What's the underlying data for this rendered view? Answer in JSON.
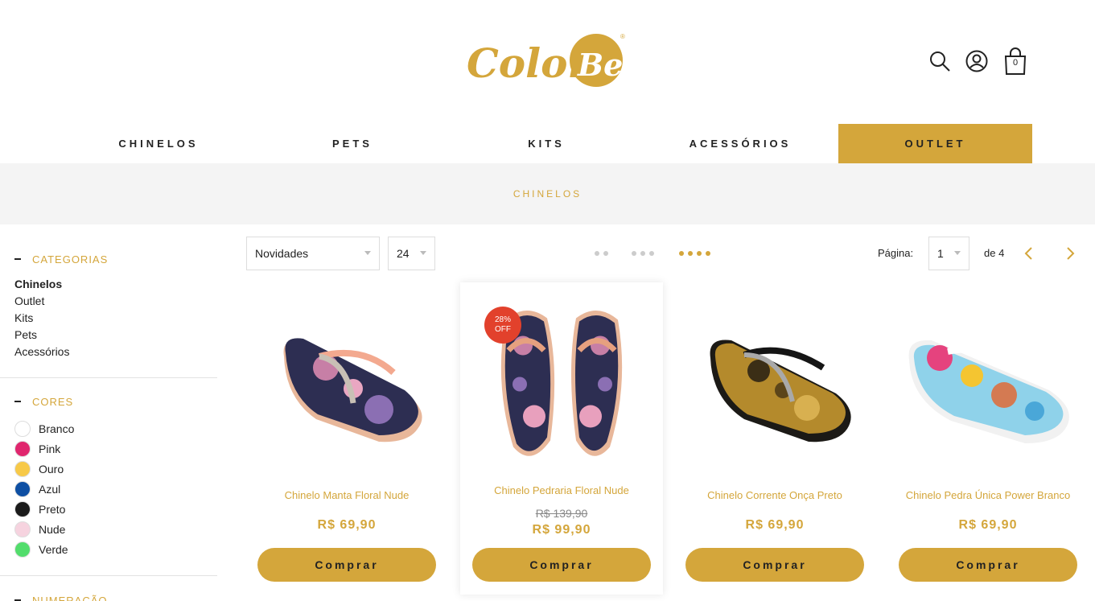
{
  "brand": {
    "name": "Color Be",
    "color": "#d4a63b"
  },
  "header": {
    "cart_count": "0"
  },
  "nav": [
    "CHINELOS",
    "PETS",
    "KITS",
    "ACESSÓRIOS",
    "OUTLET"
  ],
  "band_title": "CHINELOS",
  "sidebar": {
    "categories_title": "CATEGORIAS",
    "categories": [
      "Chinelos",
      "Outlet",
      "Kits",
      "Pets",
      "Acessórios"
    ],
    "colors_title": "CORES",
    "colors": [
      {
        "label": "Branco",
        "hex": "#ffffff"
      },
      {
        "label": "Pink",
        "hex": "#e0266e"
      },
      {
        "label": "Ouro",
        "hex": "#f7c948"
      },
      {
        "label": "Azul",
        "hex": "#0e4fa3"
      },
      {
        "label": "Preto",
        "hex": "#1b1b1b"
      },
      {
        "label": "Nude",
        "hex": "#f6d3df"
      },
      {
        "label": "Verde",
        "hex": "#52dd6c"
      }
    ],
    "size_title": "NUMERAÇÃO"
  },
  "toolbar": {
    "sort_value": "Novidades",
    "per_page_value": "24",
    "page_label": "Página:",
    "page_value": "1",
    "page_total": "de 4"
  },
  "products": [
    {
      "name": "Chinelo Manta Floral Nude",
      "price": "R$ 69,90",
      "button": "Comprar"
    },
    {
      "name": "Chinelo Pedraria Floral Nude",
      "old_price": "R$ 139,90",
      "price": "R$ 99,90",
      "button": "Comprar",
      "badge": "28% OFF"
    },
    {
      "name": "Chinelo Corrente Onça Preto",
      "price": "R$ 69,90",
      "button": "Comprar"
    },
    {
      "name": "Chinelo Pedra Única Power Branco",
      "price": "R$ 69,90",
      "button": "Comprar"
    }
  ]
}
